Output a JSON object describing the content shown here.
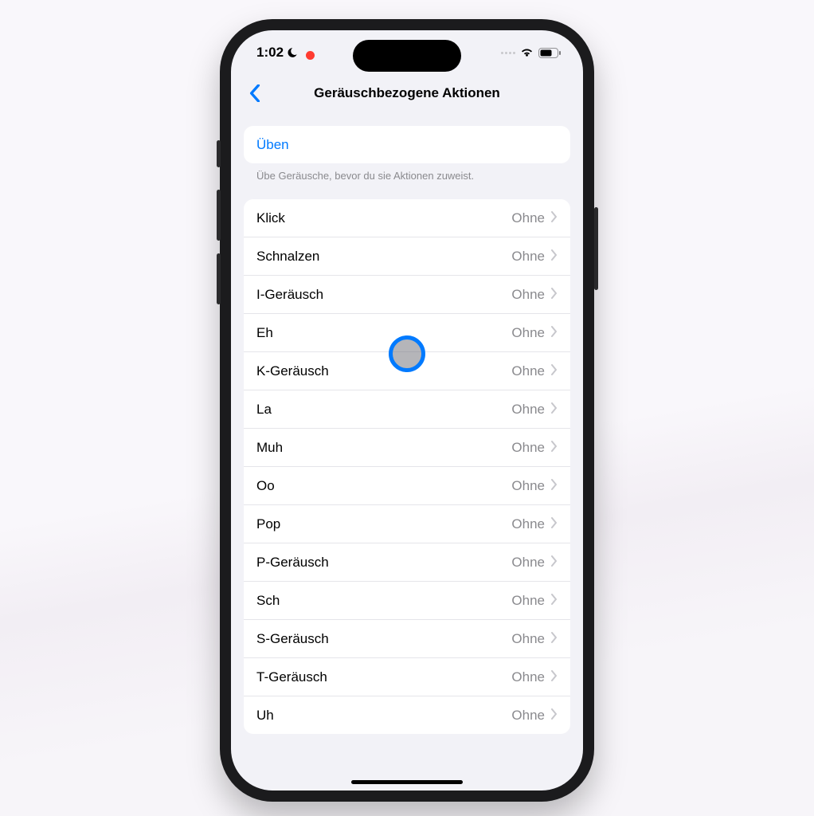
{
  "status": {
    "time": "1:02"
  },
  "header": {
    "title": "Geräuschbezogene Aktionen"
  },
  "practice": {
    "label": "Üben",
    "hint": "Übe Geräusche, bevor du sie Aktionen zuweist."
  },
  "sounds": [
    {
      "name": "Klick",
      "value": "Ohne"
    },
    {
      "name": "Schnalzen",
      "value": "Ohne"
    },
    {
      "name": "I-Geräusch",
      "value": "Ohne"
    },
    {
      "name": "Eh",
      "value": "Ohne"
    },
    {
      "name": "K-Geräusch",
      "value": "Ohne"
    },
    {
      "name": "La",
      "value": "Ohne"
    },
    {
      "name": "Muh",
      "value": "Ohne"
    },
    {
      "name": "Oo",
      "value": "Ohne"
    },
    {
      "name": "Pop",
      "value": "Ohne"
    },
    {
      "name": "P-Geräusch",
      "value": "Ohne"
    },
    {
      "name": "Sch",
      "value": "Ohne"
    },
    {
      "name": "S-Geräusch",
      "value": "Ohne"
    },
    {
      "name": "T-Geräusch",
      "value": "Ohne"
    },
    {
      "name": "Uh",
      "value": "Ohne"
    }
  ]
}
